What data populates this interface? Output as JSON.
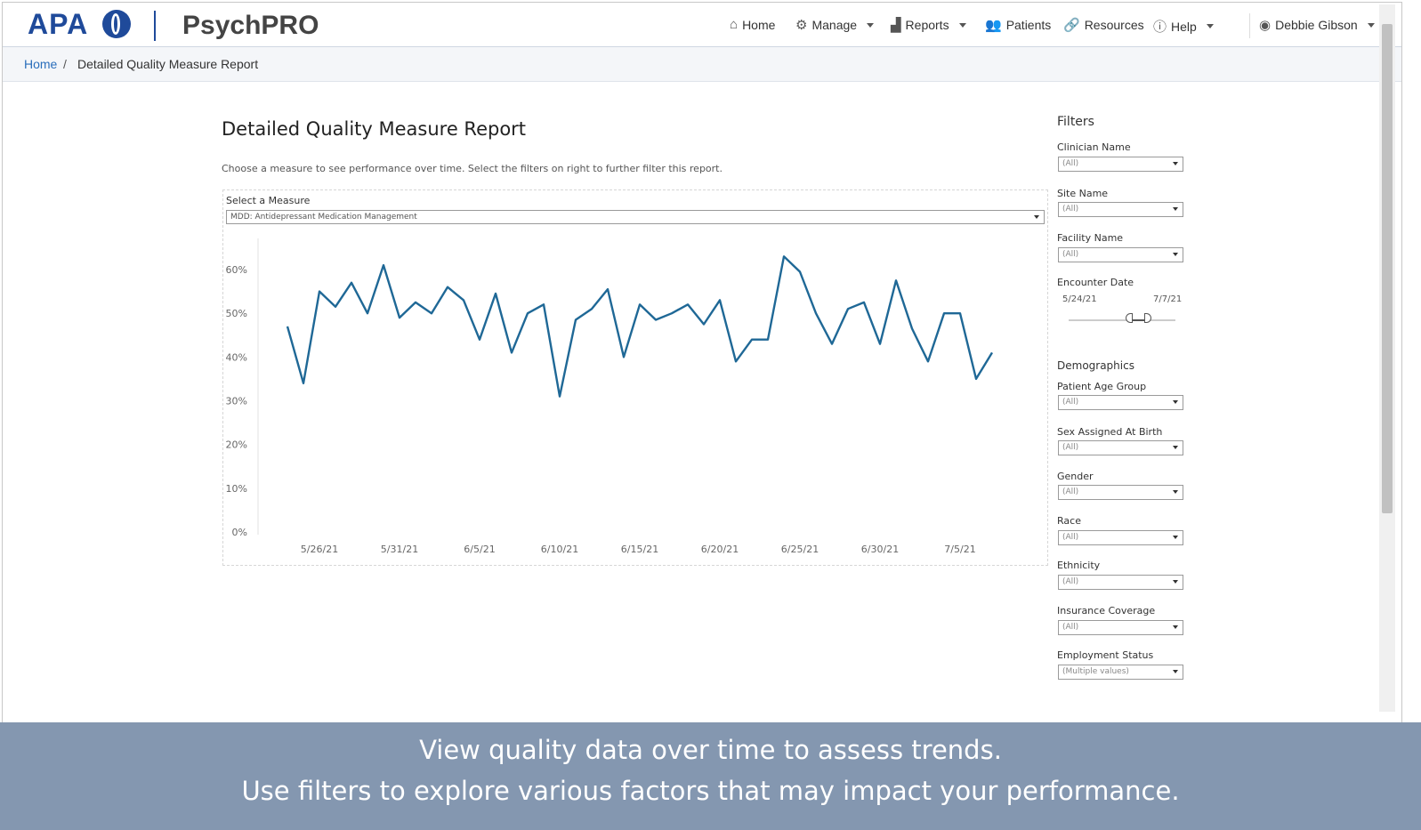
{
  "header": {
    "logo_text": "APA",
    "product": "PsychPRO",
    "nav": [
      {
        "label": "Home",
        "icon": "home-icon"
      },
      {
        "label": "Manage",
        "icon": "gear-icon",
        "dropdown": true
      },
      {
        "label": "Reports",
        "icon": "bar-chart-icon",
        "dropdown": true
      },
      {
        "label": "Patients",
        "icon": "users-icon"
      },
      {
        "label": "Resources",
        "icon": "link-icon"
      },
      {
        "label": "Help",
        "icon": "info-icon",
        "dropdown": true
      }
    ],
    "user": "Debbie Gibson"
  },
  "breadcrumb": {
    "home": "Home",
    "separator": "/",
    "current": "Detailed Quality Measure Report"
  },
  "report": {
    "title": "Detailed Quality Measure Report",
    "description": "Choose a measure to see performance over time. Select the filters on right to further filter this report.",
    "measure_label": "Select a Measure",
    "measure_value": "MDD: Antidepressant Medication Management"
  },
  "filters": {
    "title": "Filters",
    "clinician": {
      "label": "Clinician Name",
      "value": "(All)"
    },
    "site": {
      "label": "Site Name",
      "value": "(All)"
    },
    "facility": {
      "label": "Facility Name",
      "value": "(All)"
    },
    "encounter_date": {
      "label": "Encounter Date",
      "start": "5/24/21",
      "end": "7/7/21"
    },
    "demographics_title": "Demographics",
    "age": {
      "label": "Patient Age Group",
      "value": "(All)"
    },
    "sex": {
      "label": "Sex Assigned At Birth",
      "value": "(All)"
    },
    "gender": {
      "label": "Gender",
      "value": "(All)"
    },
    "race": {
      "label": "Race",
      "value": "(All)"
    },
    "ethnicity": {
      "label": "Ethnicity",
      "value": "(All)"
    },
    "insurance": {
      "label": "Insurance Coverage",
      "value": "(All)"
    },
    "employment": {
      "label": "Employment Status",
      "value": "(Multiple values)"
    }
  },
  "banner": {
    "line1": "View quality data over time to assess trends.",
    "line2": "Use filters to explore various factors that may impact your performance."
  },
  "colors": {
    "line": "#1f6896",
    "brand": "#1f4a9a",
    "banner": "#8497b0"
  },
  "chart_data": {
    "type": "line",
    "x_tick_labels": [
      "5/26/21",
      "5/31/21",
      "6/5/21",
      "6/10/21",
      "6/15/21",
      "6/20/21",
      "6/25/21",
      "6/30/21",
      "7/5/21"
    ],
    "y_tick_labels": [
      "0%",
      "10%",
      "20%",
      "30%",
      "40%",
      "50%",
      "60%"
    ],
    "ylim": [
      0,
      0.6
    ],
    "grid": false,
    "series": [
      {
        "values": [
          0.47,
          0.34,
          0.55,
          0.515,
          0.57,
          0.5,
          0.61,
          0.49,
          0.525,
          0.5,
          0.56,
          0.53,
          0.44,
          0.545,
          0.41,
          0.5,
          0.52,
          0.31,
          0.485,
          0.51,
          0.555,
          0.4,
          0.52,
          0.485,
          0.5,
          0.52,
          0.475,
          0.53,
          0.39,
          0.44,
          0.44,
          0.63,
          0.595,
          0.5,
          0.43,
          0.51,
          0.525,
          0.43,
          0.575,
          0.465,
          0.39,
          0.5,
          0.5,
          0.35,
          0.41
        ]
      }
    ]
  }
}
